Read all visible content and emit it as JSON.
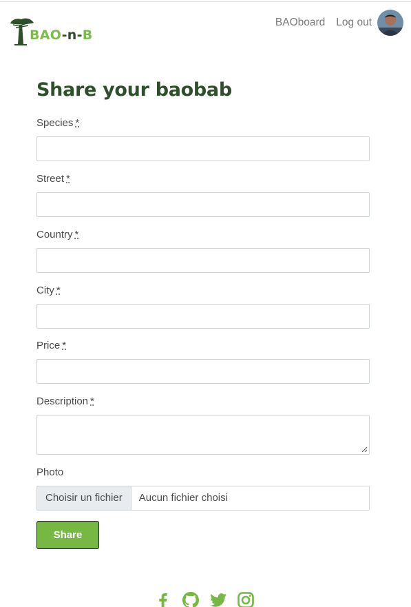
{
  "header": {
    "logo_text_a": "BAO",
    "logo_text_b": "-n-",
    "logo_text_c": "B",
    "nav": [
      {
        "label": "BAOboard"
      },
      {
        "label": "Log out"
      }
    ]
  },
  "page_title": "Share your baobab",
  "form": {
    "required_marker": "*",
    "fields": [
      {
        "label": "Species",
        "value": ""
      },
      {
        "label": "Street",
        "value": ""
      },
      {
        "label": "Country",
        "value": ""
      },
      {
        "label": "City",
        "value": ""
      },
      {
        "label": "Price",
        "value": ""
      },
      {
        "label": "Description",
        "value": ""
      }
    ],
    "photo": {
      "label": "Photo",
      "button_label": "Choisir un fichier",
      "status": "Aucun fichier choisi"
    },
    "submit_label": "Share"
  },
  "footer": {
    "social_icons": [
      "facebook-icon",
      "github-icon",
      "twitter-icon",
      "instagram-icon"
    ]
  },
  "colors": {
    "brand_green": "#76b843",
    "title_dark_green": "#2f4e2c"
  }
}
